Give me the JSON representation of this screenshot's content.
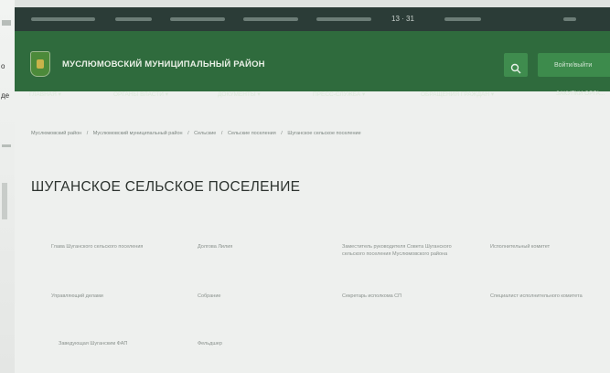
{
  "left_fragments": [
    "o",
    "де"
  ],
  "topbar": {
    "weather": "13 · 31"
  },
  "header": {
    "site_title": "МУСЛЮМОВСКИЙ МУНИЦИПАЛЬНЫЙ РАЙОН",
    "login_label": "Войти/выйти"
  },
  "nav": {
    "items": [
      "Главная ▾",
      "Органы власти ▾",
      "Документы ▾",
      "Пресс-служба ▾",
      "Обращения граждан ▾",
      "Закупки орга..."
    ]
  },
  "breadcrumb": [
    "Муслюмовский район",
    "/",
    "Муслюмовский муниципальный район",
    "/",
    "Сельские",
    "/",
    "Сельские поселения",
    "/",
    "Шуганское сельское поселение"
  ],
  "page_title": "ШУГАНСКОЕ СЕЛЬСКОЕ ПОСЕЛЕНИЕ",
  "info_rows": [
    {
      "col1": "Глава Шуганского сельского поселения",
      "col2": "Долгова Лилия",
      "col3": "Заместитель руководителя Совета Шуганского сельского поселения Муслюмовского района",
      "col4": "Исполнительный комитет"
    },
    {
      "col1": "Управляющий делами",
      "col2": "Собрание",
      "col3": "Секретарь исполкома СП",
      "col4": "Специалист исполнительного комитета"
    },
    {
      "col1": "Заведующая Шуганским ФАП",
      "col2": "Фельдшер",
      "col3": "",
      "col4": ""
    }
  ]
}
